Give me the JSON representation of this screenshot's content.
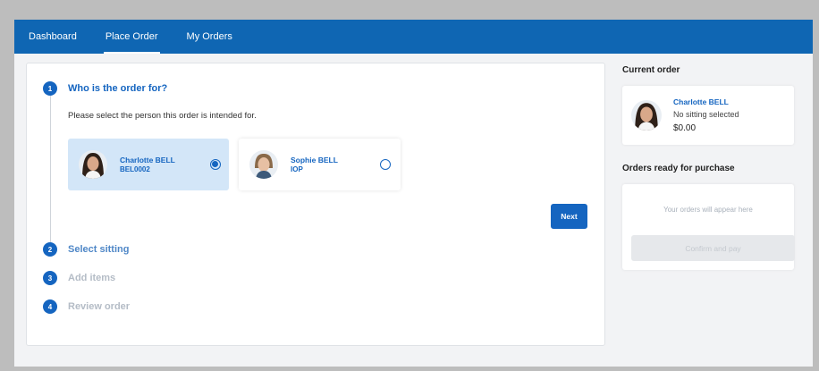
{
  "nav": {
    "tabs": [
      {
        "label": "Dashboard"
      },
      {
        "label": "Place Order"
      },
      {
        "label": "My Orders"
      }
    ]
  },
  "wizard": {
    "steps": [
      {
        "number": "1",
        "label": "Who is the order for?"
      },
      {
        "number": "2",
        "label": "Select sitting"
      },
      {
        "number": "3",
        "label": "Add items"
      },
      {
        "number": "4",
        "label": "Review order"
      }
    ],
    "instruction": "Please select the person this order is intended for.",
    "people": [
      {
        "name": "Charlotte BELL",
        "code": "BEL0002",
        "selected": true
      },
      {
        "name": "Sophie BELL",
        "code": "IOP",
        "selected": false
      }
    ],
    "next_label": "Next"
  },
  "sidebar": {
    "current_title": "Current order",
    "current": {
      "name": "Charlotte BELL",
      "sitting": "No sitting selected",
      "price": "$0.00"
    },
    "ready_title": "Orders ready for purchase",
    "ready_empty": "Your orders will appear here",
    "pay_label": "Confirm and pay"
  },
  "colors": {
    "brand": "#0f66b3",
    "accent": "#1565c0",
    "selected_card": "#d3e6f8"
  }
}
